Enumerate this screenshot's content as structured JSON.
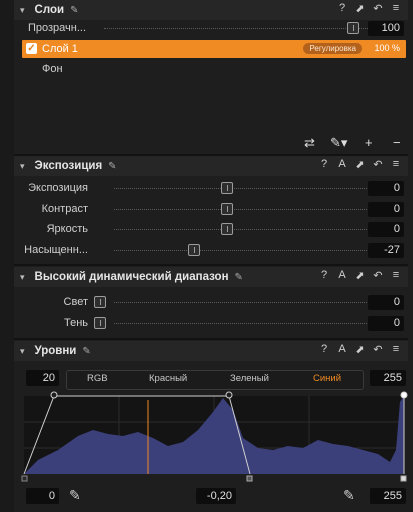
{
  "layers": {
    "title": "Слои",
    "opacity_label": "Прозрачн...",
    "opacity_value": "100",
    "items": [
      {
        "name": "Слой 1",
        "badge": "Регулировка",
        "percent": "100 %",
        "checked": true
      },
      {
        "name": "Фон"
      }
    ],
    "tools": [
      "sliders-icon",
      "brush-icon",
      "add-icon",
      "remove-icon"
    ]
  },
  "exposure": {
    "title": "Экспозиция",
    "rows": [
      {
        "label": "Экспозиция",
        "value": "0",
        "level": 0.5
      },
      {
        "label": "Контраст",
        "value": "0",
        "level": 0.5
      },
      {
        "label": "Яркость",
        "value": "0",
        "level": 0.5
      },
      {
        "label": "Насыщенн...",
        "value": "-27",
        "level": 0.37
      }
    ]
  },
  "hdr": {
    "title": "Высокий динамический диапазон",
    "rows": [
      {
        "label": "Свет",
        "value": "0"
      },
      {
        "label": "Тень",
        "value": "0"
      }
    ]
  },
  "levels": {
    "title": "Уровни",
    "input_low": "20",
    "input_high": "255",
    "tabs": [
      "RGB",
      "Красный",
      "Зеленый",
      "Синий"
    ],
    "active_tab": "Синий",
    "output_low": "0",
    "midtone": "-0,20",
    "output_high": "255"
  },
  "colors": {
    "accent": "#f08a23",
    "histogram": "#3b3f7a",
    "panel": "#1e1e1e"
  }
}
